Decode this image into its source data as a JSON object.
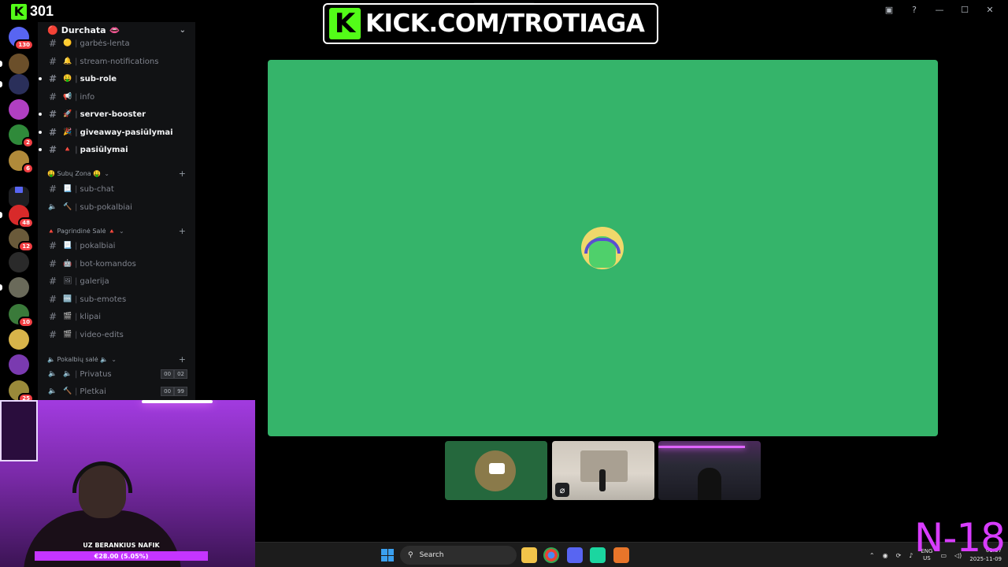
{
  "viewer": {
    "count": "301",
    "logo": "K"
  },
  "banner": {
    "logo": "K",
    "url": "KICK.COM/TROTIAGA"
  },
  "window_controls": [
    "gallery-icon",
    "help-icon",
    "minimize-icon",
    "maximize-icon",
    "close-icon"
  ],
  "server_rail": [
    {
      "name": "server-1",
      "badge": "130",
      "color": "#5865f2"
    },
    {
      "name": "server-2",
      "badge": "",
      "color": "#6b4f2a"
    },
    {
      "name": "server-3",
      "badge": "",
      "color": "#2a2f5a"
    },
    {
      "name": "server-4",
      "badge": "",
      "color": "#b03fc2"
    },
    {
      "name": "server-5",
      "badge": "2",
      "color": "#2f8a3a"
    },
    {
      "name": "server-6",
      "badge": "6",
      "color": "#b08a3a"
    },
    {
      "name": "folder",
      "badge": "",
      "color": "#1e1f22"
    },
    {
      "name": "server-7",
      "badge": "48",
      "color": "#d82a2a"
    },
    {
      "name": "server-8",
      "badge": "12",
      "color": "#6a5a3a"
    },
    {
      "name": "server-9",
      "badge": "",
      "color": "#2a2a2a"
    },
    {
      "name": "server-10",
      "badge": "",
      "color": "#6a6a5a"
    },
    {
      "name": "server-11",
      "badge": "10",
      "color": "#3a7a3a"
    },
    {
      "name": "server-12",
      "badge": "",
      "color": "#d8b44a"
    },
    {
      "name": "server-13",
      "badge": "",
      "color": "#7a3ab0"
    },
    {
      "name": "server-14",
      "badge": "25",
      "color": "#9a8a3a"
    }
  ],
  "guild": {
    "emoji": "🔴",
    "name": "Durchata",
    "emoji_end": "👄"
  },
  "channels": {
    "top": [
      {
        "name": "garbės-lenta",
        "emoji": "🟡",
        "bold": false
      },
      {
        "name": "stream-notifications",
        "emoji": "🔔",
        "bold": false
      },
      {
        "name": "sub-role",
        "emoji": "🤑",
        "bold": true
      },
      {
        "name": "info",
        "emoji": "📢",
        "bold": false
      },
      {
        "name": "server-booster",
        "emoji": "🚀",
        "bold": true
      },
      {
        "name": "giveaway-pasiūlymai",
        "emoji": "🎉",
        "bold": true
      },
      {
        "name": "pasiūlymai",
        "emoji": "🔺",
        "bold": true
      }
    ],
    "sub_zone": {
      "title": "🤑 Subų Zona 🤑",
      "items": [
        {
          "name": "sub-chat",
          "emoji": "📃",
          "type": "text"
        },
        {
          "name": "sub-pokalbiai",
          "emoji": "🔨",
          "type": "voice"
        }
      ]
    },
    "main_hall": {
      "title": "🔺 Pagrindinė Salė 🔺",
      "items": [
        {
          "name": "pokalbiai",
          "emoji": "📃"
        },
        {
          "name": "bot-komandos",
          "emoji": "🤖"
        },
        {
          "name": "galerija",
          "emoji": "🖼"
        },
        {
          "name": "sub-emotes",
          "emoji": "🆒"
        },
        {
          "name": "klipai",
          "emoji": "🎬"
        },
        {
          "name": "video-edits",
          "emoji": "🎬"
        }
      ]
    },
    "voice_hall": {
      "title": "🔈 Pokalbių salė 🔈",
      "items": [
        {
          "name": "Privatus",
          "emoji": "🔈",
          "count_a": "00",
          "count_b": "02"
        },
        {
          "name": "Pletkai",
          "emoji": "🔨",
          "count_a": "00",
          "count_b": "99"
        }
      ]
    }
  },
  "call": {
    "tile_color": "#35b46a"
  },
  "webcam": {
    "donor": "UZ BERANKIUS NAFIK",
    "amount": "€28.00 (5.05%)"
  },
  "taskbar": {
    "search_placeholder": "Search",
    "lang_top": "ENG",
    "lang_bottom": "US",
    "time": "01:37",
    "date": "2025-11-09"
  },
  "overlay": {
    "rating": "N-18"
  }
}
